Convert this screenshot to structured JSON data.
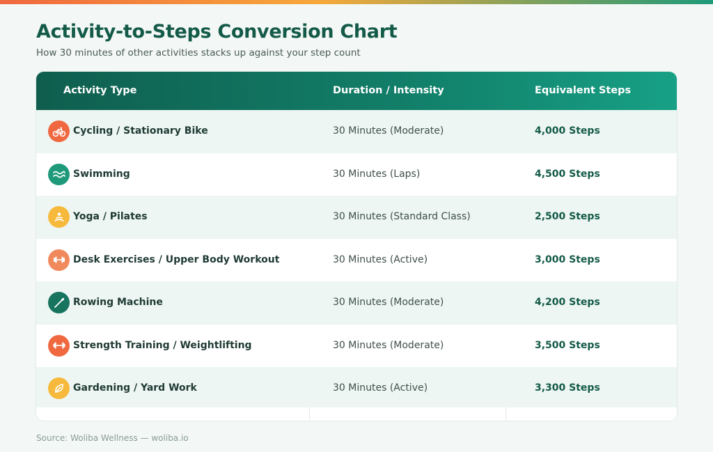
{
  "header": {
    "title": "Activity-to-Steps Conversion Chart",
    "subtitle": "How 30 minutes of other activities stacks up against your step count"
  },
  "table": {
    "columns": [
      "Activity Type",
      "Duration / Intensity",
      "Equivalent Steps"
    ],
    "rows": [
      {
        "icon": "bicycle-icon",
        "activity": "Cycling / Stationary Bike",
        "duration": "30 Minutes (Moderate)",
        "steps": "4,000 Steps",
        "icon_color": "#f0683f"
      },
      {
        "icon": "waves-icon",
        "activity": "Swimming",
        "duration": "30 Minutes (Laps)",
        "steps": "4,500 Steps",
        "icon_color": "#1e9a7a"
      },
      {
        "icon": "meditation-icon",
        "activity": "Yoga / Pilates",
        "duration": "30 Minutes (Standard Class)",
        "steps": "2,500 Steps",
        "icon_color": "#f6b93b"
      },
      {
        "icon": "dumbbell-icon",
        "activity": "Desk Exercises / Upper Body Workout",
        "duration": "30 Minutes (Active)",
        "steps": "3,000 Steps",
        "icon_color": "#f08a5d"
      },
      {
        "icon": "oar-icon",
        "activity": "Rowing Machine",
        "duration": "30 Minutes (Moderate)",
        "steps": "4,200 Steps",
        "icon_color": "#17745f"
      },
      {
        "icon": "barbell-icon",
        "activity": "Strength Training / Weightlifting",
        "duration": "30 Minutes (Moderate)",
        "steps": "3,500 Steps",
        "icon_color": "#f0683f"
      },
      {
        "icon": "leaf-icon",
        "activity": "Gardening / Yard Work",
        "duration": "30 Minutes (Active)",
        "steps": "3,300 Steps",
        "icon_color": "#f6b93b"
      }
    ]
  },
  "footer": {
    "source": "Source: Woliba Wellness — woliba.io"
  },
  "colors": {
    "brand_dark": "#145a48",
    "header_gradient_start": "#0f5e4e",
    "header_gradient_end": "#17a085",
    "row_alt": "#edf6f2"
  }
}
